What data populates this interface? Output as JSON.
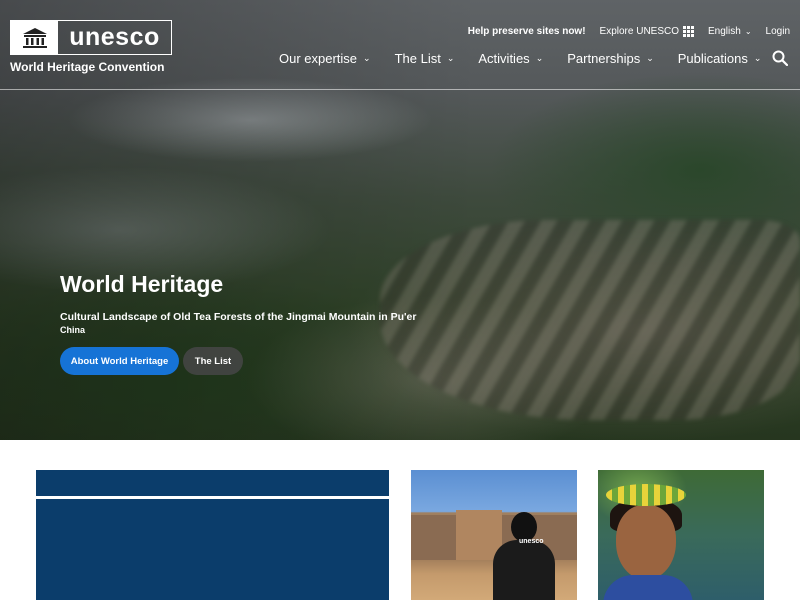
{
  "brand": {
    "logo_text": "unesco",
    "subtitle": "World Heritage Convention"
  },
  "utility_nav": {
    "help_link": "Help preserve sites now!",
    "explore_label": "Explore UNESCO",
    "language": "English",
    "login": "Login"
  },
  "main_nav": {
    "items": [
      {
        "label": "Our expertise"
      },
      {
        "label": "The List"
      },
      {
        "label": "Activities"
      },
      {
        "label": "Partnerships"
      },
      {
        "label": "Publications"
      }
    ]
  },
  "hero": {
    "title": "World Heritage",
    "site_name": "Cultural Landscape of Old Tea Forests of the Jingmai Mountain in Pu'er",
    "country": "China",
    "primary_button": "About World Heritage",
    "secondary_button": "The List"
  },
  "cards": {
    "photo1_badge": "unesco"
  },
  "colors": {
    "primary_button": "#1673d6",
    "card_blue": "#0b3d6b"
  }
}
